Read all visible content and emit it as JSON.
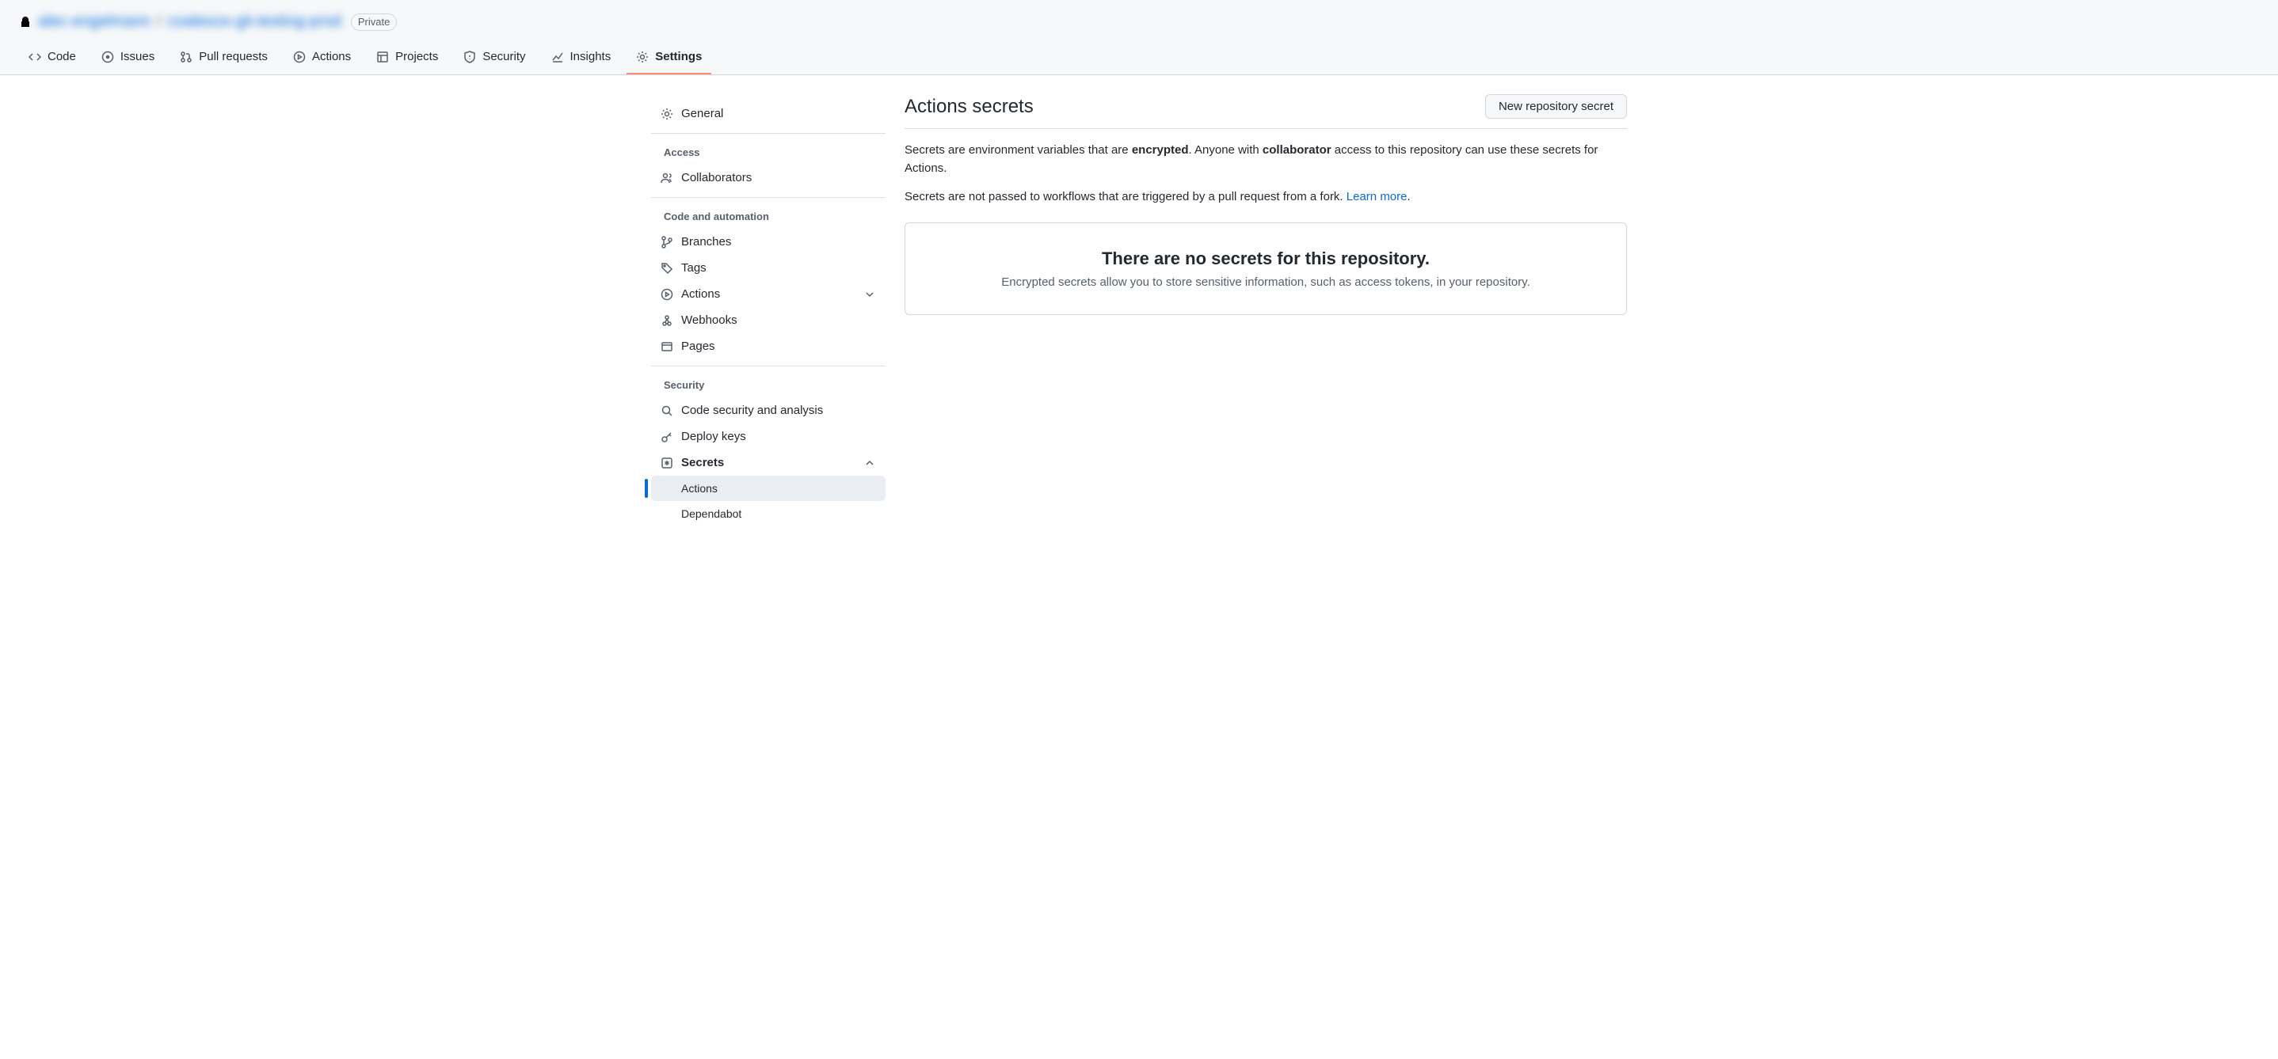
{
  "breadcrumb": {
    "owner": "alec-engelmann",
    "repo": "coalesce-git-testing-prod",
    "visibility": "Private"
  },
  "tabs": [
    {
      "label": "Code",
      "icon": "code-icon"
    },
    {
      "label": "Issues",
      "icon": "issues-icon"
    },
    {
      "label": "Pull requests",
      "icon": "pr-icon"
    },
    {
      "label": "Actions",
      "icon": "play-icon"
    },
    {
      "label": "Projects",
      "icon": "projects-icon"
    },
    {
      "label": "Security",
      "icon": "shield-icon"
    },
    {
      "label": "Insights",
      "icon": "graph-icon"
    },
    {
      "label": "Settings",
      "icon": "gear-icon",
      "active": true
    }
  ],
  "sidebar": {
    "general": "General",
    "access_heading": "Access",
    "collaborators": "Collaborators",
    "code_heading": "Code and automation",
    "branches": "Branches",
    "tags": "Tags",
    "actions": "Actions",
    "webhooks": "Webhooks",
    "pages": "Pages",
    "security_heading": "Security",
    "code_security": "Code security and analysis",
    "deploy_keys": "Deploy keys",
    "secrets": "Secrets",
    "secrets_actions": "Actions",
    "secrets_dependabot": "Dependabot"
  },
  "content": {
    "title": "Actions secrets",
    "new_button": "New repository secret",
    "desc1_a": "Secrets are environment variables that are ",
    "desc1_b": "encrypted",
    "desc1_c": ". Anyone with ",
    "desc1_d": "collaborator",
    "desc1_e": " access to this repository can use these secrets for Actions.",
    "desc2_a": "Secrets are not passed to workflows that are triggered by a pull request from a fork. ",
    "desc2_link": "Learn more",
    "desc2_b": ".",
    "empty_title": "There are no secrets for this repository.",
    "empty_text": "Encrypted secrets allow you to store sensitive information, such as access tokens, in your repository."
  }
}
